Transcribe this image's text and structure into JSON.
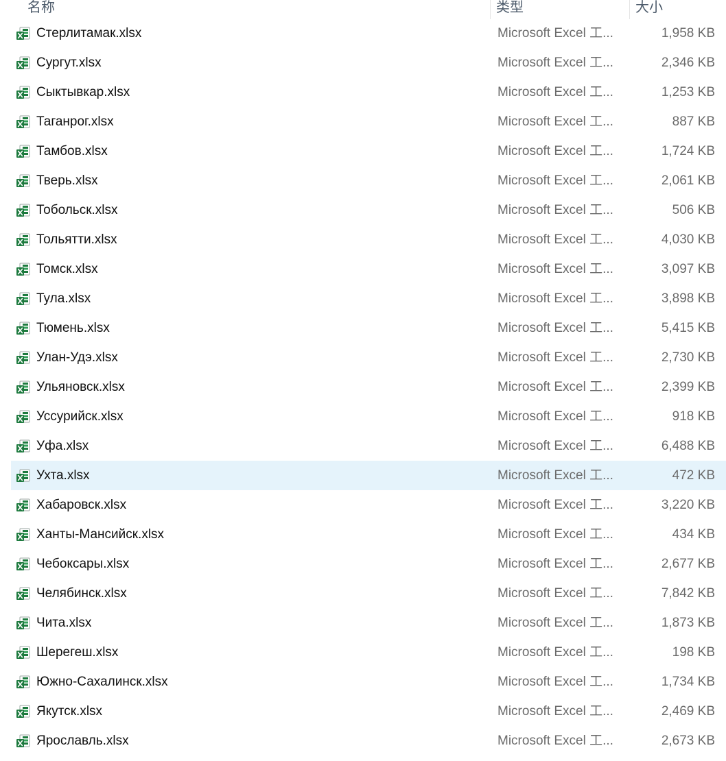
{
  "columns": {
    "name": "名称",
    "type": "类型",
    "size": "大小"
  },
  "selected_index": 15,
  "icon": "excel-file-icon",
  "colors": {
    "selection": "#e5f3fb",
    "excel_green": "#1d7a3e",
    "secondary_text": "#6b6b6b"
  },
  "files": [
    {
      "name": "Стерлитамак.xlsx",
      "type": "Microsoft Excel 工...",
      "size": "1,958 KB"
    },
    {
      "name": "Сургут.xlsx",
      "type": "Microsoft Excel 工...",
      "size": "2,346 KB"
    },
    {
      "name": "Сыктывкар.xlsx",
      "type": "Microsoft Excel 工...",
      "size": "1,253 KB"
    },
    {
      "name": "Таганрог.xlsx",
      "type": "Microsoft Excel 工...",
      "size": "887 KB"
    },
    {
      "name": "Тамбов.xlsx",
      "type": "Microsoft Excel 工...",
      "size": "1,724 KB"
    },
    {
      "name": "Тверь.xlsx",
      "type": "Microsoft Excel 工...",
      "size": "2,061 KB"
    },
    {
      "name": "Тобольск.xlsx",
      "type": "Microsoft Excel 工...",
      "size": "506 KB"
    },
    {
      "name": "Тольятти.xlsx",
      "type": "Microsoft Excel 工...",
      "size": "4,030 KB"
    },
    {
      "name": "Томск.xlsx",
      "type": "Microsoft Excel 工...",
      "size": "3,097 KB"
    },
    {
      "name": "Тула.xlsx",
      "type": "Microsoft Excel 工...",
      "size": "3,898 KB"
    },
    {
      "name": "Тюмень.xlsx",
      "type": "Microsoft Excel 工...",
      "size": "5,415 KB"
    },
    {
      "name": "Улан-Удэ.xlsx",
      "type": "Microsoft Excel 工...",
      "size": "2,730 KB"
    },
    {
      "name": "Ульяновск.xlsx",
      "type": "Microsoft Excel 工...",
      "size": "2,399 KB"
    },
    {
      "name": "Уссурийск.xlsx",
      "type": "Microsoft Excel 工...",
      "size": "918 KB"
    },
    {
      "name": "Уфа.xlsx",
      "type": "Microsoft Excel 工...",
      "size": "6,488 KB"
    },
    {
      "name": "Ухта.xlsx",
      "type": "Microsoft Excel 工...",
      "size": "472 KB"
    },
    {
      "name": "Хабаровск.xlsx",
      "type": "Microsoft Excel 工...",
      "size": "3,220 KB"
    },
    {
      "name": "Ханты-Мансийск.xlsx",
      "type": "Microsoft Excel 工...",
      "size": "434 KB"
    },
    {
      "name": "Чебоксары.xlsx",
      "type": "Microsoft Excel 工...",
      "size": "2,677 KB"
    },
    {
      "name": "Челябинск.xlsx",
      "type": "Microsoft Excel 工...",
      "size": "7,842 KB"
    },
    {
      "name": "Чита.xlsx",
      "type": "Microsoft Excel 工...",
      "size": "1,873 KB"
    },
    {
      "name": "Шерегеш.xlsx",
      "type": "Microsoft Excel 工...",
      "size": "198 KB"
    },
    {
      "name": "Южно-Сахалинск.xlsx",
      "type": "Microsoft Excel 工...",
      "size": "1,734 KB"
    },
    {
      "name": "Якутск.xlsx",
      "type": "Microsoft Excel 工...",
      "size": "2,469 KB"
    },
    {
      "name": "Ярославль.xlsx",
      "type": "Microsoft Excel 工...",
      "size": "2,673 KB"
    }
  ]
}
